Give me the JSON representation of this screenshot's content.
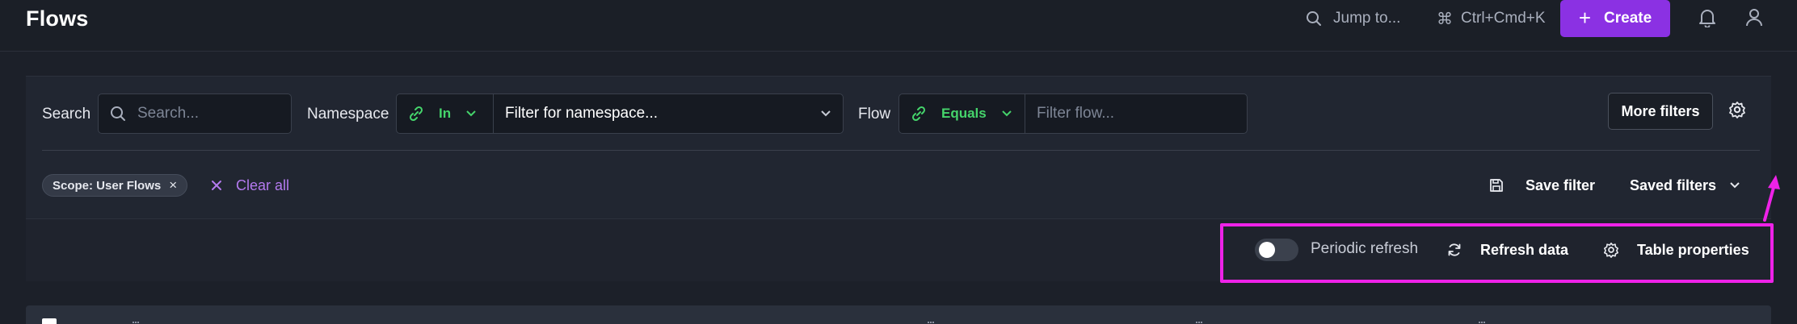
{
  "header": {
    "title": "Flows",
    "jump_label": "Jump to...",
    "shortcut_label": "Ctrl+Cmd+K",
    "create_label": "Create"
  },
  "filters": {
    "search_label": "Search",
    "search_placeholder": "Search...",
    "namespace_label": "Namespace",
    "namespace_operator": "In",
    "namespace_placeholder": "Filter for namespace...",
    "flow_label": "Flow",
    "flow_operator": "Equals",
    "flow_placeholder": "Filter flow...",
    "more_filters_label": "More filters",
    "active_chip": "Scope: User Flows",
    "clear_all_label": "Clear all",
    "save_filter_label": "Save filter",
    "saved_filters_label": "Saved filters"
  },
  "toolbar": {
    "periodic_refresh_label": "Periodic refresh",
    "periodic_refresh_on": false,
    "refresh_label": "Refresh data",
    "table_properties_label": "Table properties"
  },
  "colors": {
    "accent": "#8b31e3",
    "operator_green": "#45d46b",
    "link_purple": "#b47af0",
    "annotation": "#ee22e8"
  }
}
